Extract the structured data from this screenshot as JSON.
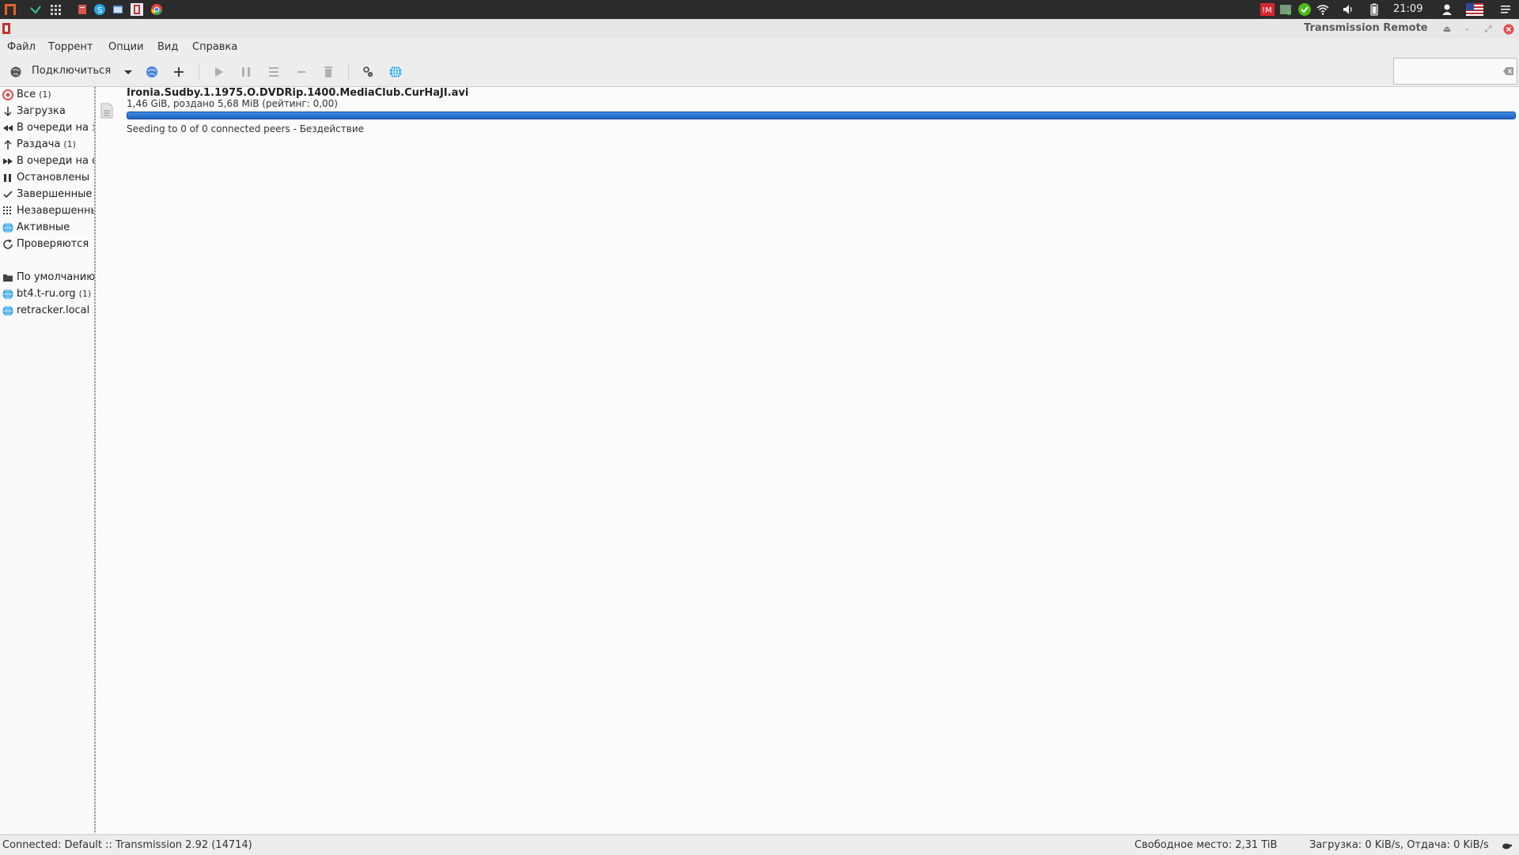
{
  "system_panel": {
    "clock": "21:09",
    "left_icons": [
      "app-menu-icon",
      "checkmark-icon",
      "apps-grid-icon",
      "files-icon",
      "skype-icon",
      "window-icon",
      "transmission-icon",
      "chrome-icon"
    ],
    "tray_icons": [
      "mega-icon",
      "network-icon",
      "sync-check-icon",
      "wifi-icon",
      "volume-icon",
      "battery-icon",
      "user-icon",
      "us-flag-icon",
      "menu-icon"
    ]
  },
  "window": {
    "title": "Transmission Remote",
    "buttons": [
      "eject-icon",
      "minimize-icon",
      "restore-icon",
      "close-icon"
    ]
  },
  "menu": {
    "items": [
      {
        "label": "Файл"
      },
      {
        "label": "Торрент"
      },
      {
        "label": "Опции"
      },
      {
        "label": "Вид"
      },
      {
        "label": "Справка"
      }
    ]
  },
  "toolbar": {
    "connect_label": "Подключиться",
    "search_value": ""
  },
  "sidebar": {
    "filters": [
      {
        "label": "Все",
        "count": "(1)",
        "icon": "all-icon"
      },
      {
        "label": "Загрузка",
        "count": "",
        "icon": "arrow-down-icon"
      },
      {
        "label": "В очереди на з",
        "count": "",
        "icon": "queue-back-icon"
      },
      {
        "label": "Раздача",
        "count": "(1)",
        "icon": "arrow-up-icon"
      },
      {
        "label": "В очереди на о",
        "count": "",
        "icon": "queue-forward-icon"
      },
      {
        "label": "Остановлены",
        "count": "",
        "icon": "pause-icon"
      },
      {
        "label": "Завершенные",
        "count": "",
        "icon": "check-icon"
      },
      {
        "label": "Незавершенные",
        "count": "",
        "icon": "incomplete-icon"
      },
      {
        "label": "Активные",
        "count": "",
        "icon": "globe-icon"
      },
      {
        "label": "Проверяются",
        "count": "",
        "icon": "refresh-icon"
      }
    ],
    "groups": [
      {
        "label": "По умолчанию",
        "count": "",
        "icon": "folder-icon"
      },
      {
        "label": "bt4.t-ru.org",
        "count": "(1)",
        "icon": "globe-icon"
      },
      {
        "label": "retracker.local",
        "count": "",
        "icon": "globe-icon"
      }
    ]
  },
  "torrent": {
    "name": "Ironia.Sudby.1.1975.O.DVDRip.1400.MediaClub.CurHaJI.avi",
    "size_info": "1,46 GiB, роздано 5,68 MiB (рейтинг: 0,00)",
    "progress_percent": 100,
    "status": "Seeding to 0 of 0 connected peers - Бездействие"
  },
  "statusbar": {
    "connection": "Connected: Default :: Transmission 2.92 (14714)",
    "free_space": "Свободное место: 2,31 TiB",
    "speeds": "Загрузка: 0 KiB/s, Отдача: 0 KiB/s"
  },
  "colors": {
    "progress": "#1f63c6",
    "globe": "#2fa3e6",
    "panel": "#2b2b2b"
  }
}
